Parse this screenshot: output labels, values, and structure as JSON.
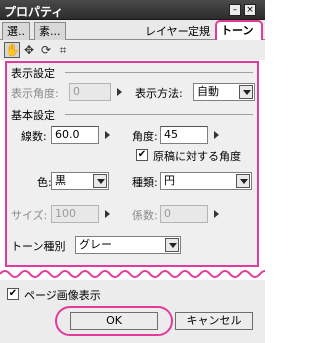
{
  "window": {
    "title": "プロパティ",
    "minimize_icon": "minimize-icon",
    "close_icon": "close-icon"
  },
  "tabs": [
    {
      "label": "選.."
    },
    {
      "label": "素..."
    },
    {
      "label": "レイヤー"
    },
    {
      "label": "定規"
    },
    {
      "label": "トーン"
    }
  ],
  "toolbar": {
    "tools": [
      "hand-icon",
      "move-icon",
      "rotate-icon",
      "transform-icon"
    ]
  },
  "display_settings": {
    "section_label": "表示設定",
    "angle_label": "表示角度:",
    "angle_value": "0",
    "method_label": "表示方法:",
    "method_value": "自動"
  },
  "basic_settings": {
    "section_label": "基本設定",
    "lines_label": "線数:",
    "lines_value": "60.0",
    "angle_label": "角度:",
    "angle_value": "45",
    "original_angle_label": "原稿に対する角度",
    "original_angle_checked": true,
    "color_label": "色:",
    "color_value": "黒",
    "type_label": "種類:",
    "type_value": "円",
    "size_label": "サイズ:",
    "size_value": "100",
    "coef_label": "係数:",
    "coef_value": "0",
    "tone_type_label": "トーン種別",
    "tone_type_value": "グレー"
  },
  "bottom": {
    "page_image_label": "ページ画像表示",
    "page_image_checked": true,
    "ok_label": "OK",
    "cancel_label": "キャンセル"
  },
  "accent_color": "#e23b9b"
}
